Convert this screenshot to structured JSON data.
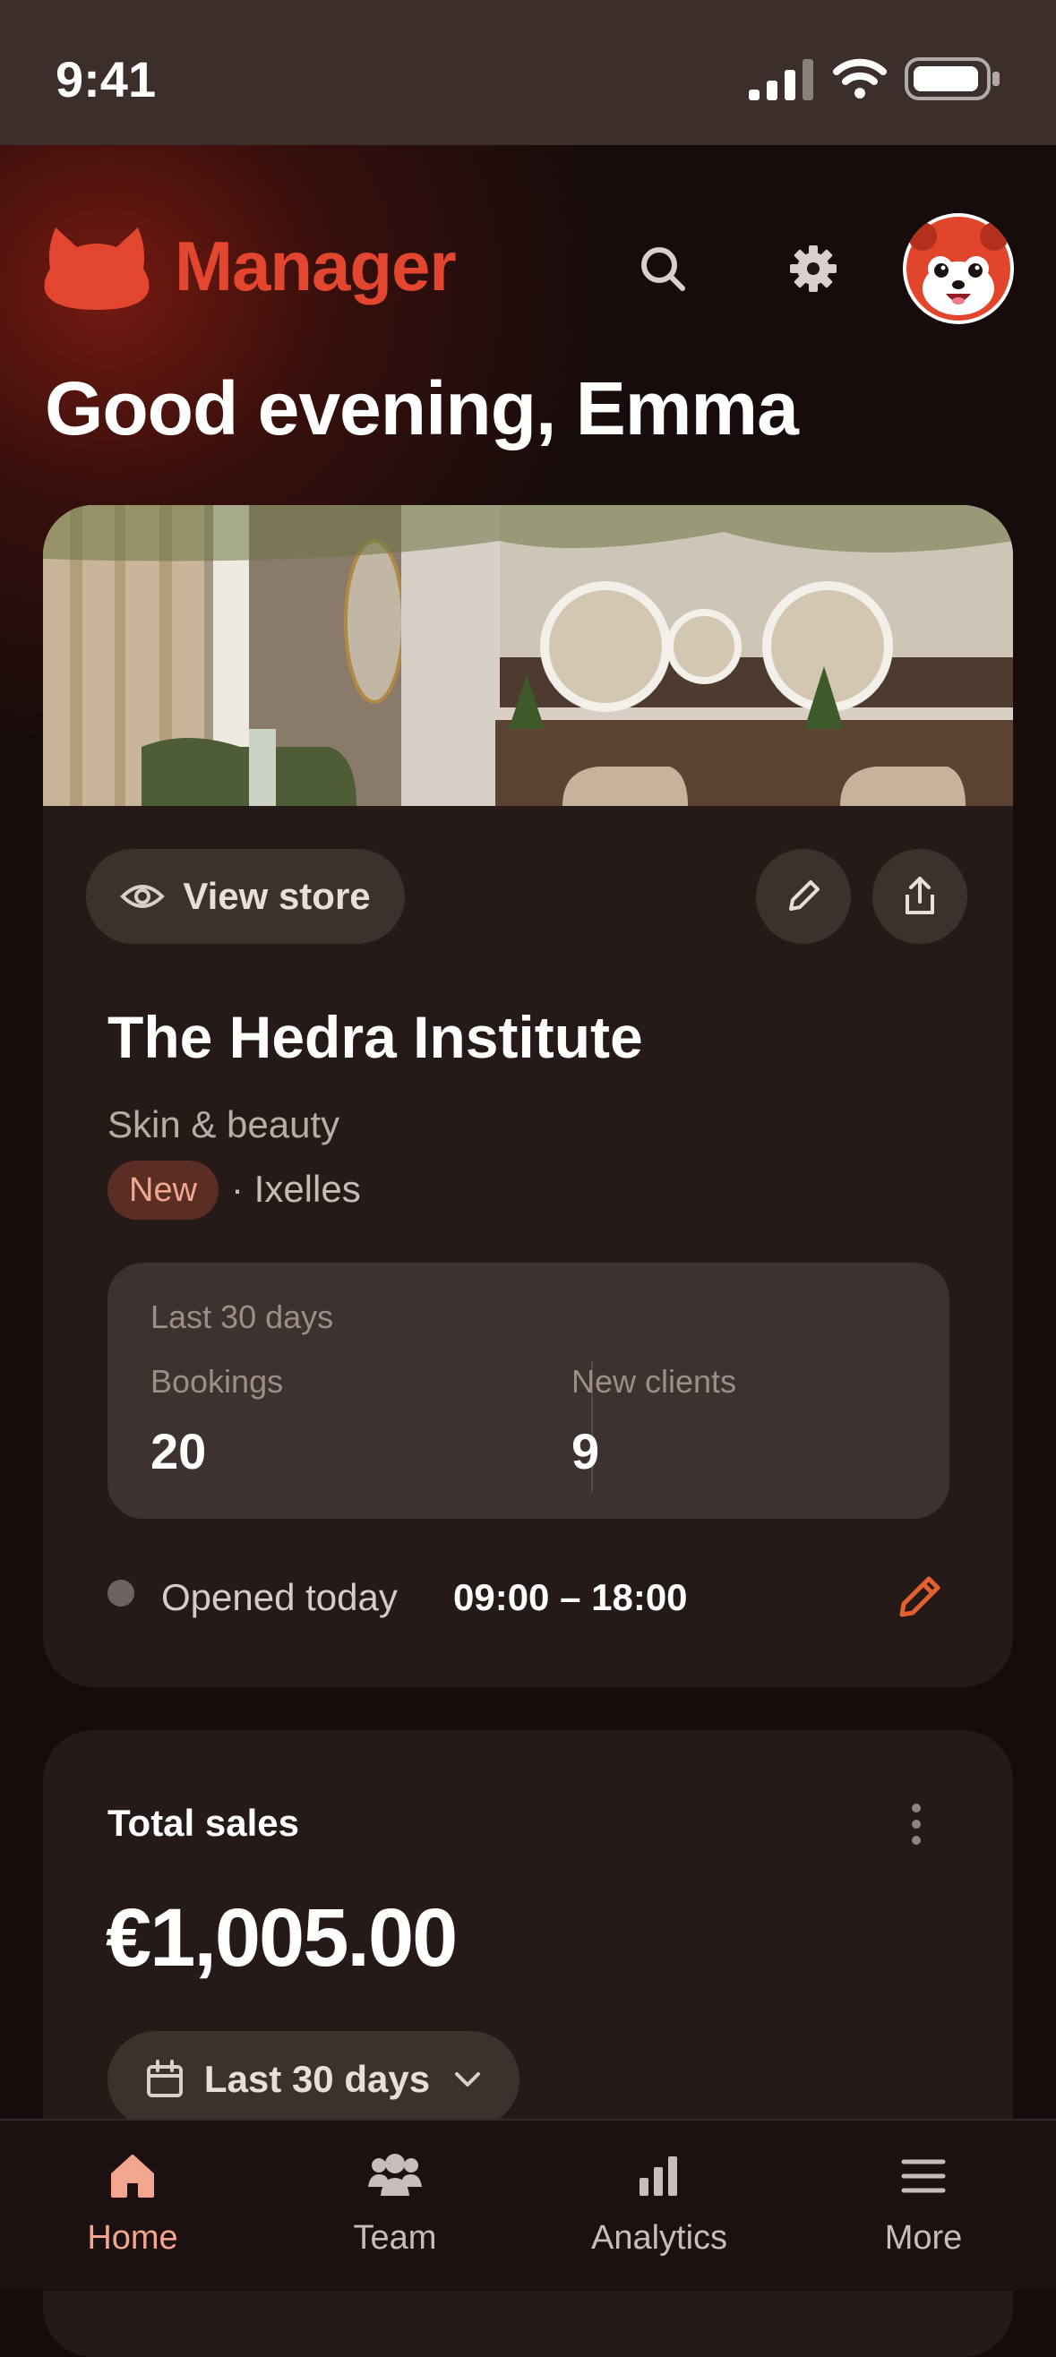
{
  "status_bar": {
    "time": "9:41"
  },
  "header": {
    "app_name": "Manager",
    "greeting": "Good evening, Emma"
  },
  "store": {
    "view_store_label": "View store",
    "name": "The Hedra Institute",
    "category": "Skin & beauty",
    "badge": "New",
    "location": "· Ixelles",
    "stats": {
      "period": "Last 30 days",
      "bookings_label": "Bookings",
      "bookings_value": "20",
      "new_clients_label": "New clients",
      "new_clients_value": "9"
    },
    "hours": {
      "status": "Opened today",
      "range": "09:00 – 18:00"
    }
  },
  "sales": {
    "title": "Total sales",
    "amount": "€1,005.00",
    "range_label": "Last 30 days"
  },
  "tabs": [
    {
      "label": "Home",
      "icon": "home-icon",
      "active": true
    },
    {
      "label": "Team",
      "icon": "team-icon",
      "active": false
    },
    {
      "label": "Analytics",
      "icon": "analytics-icon",
      "active": false
    },
    {
      "label": "More",
      "icon": "menu-icon",
      "active": false
    }
  ],
  "colors": {
    "brand": "#e2462f",
    "accent": "#f2a58f",
    "background": "#170c0b",
    "card": "#261a18"
  }
}
